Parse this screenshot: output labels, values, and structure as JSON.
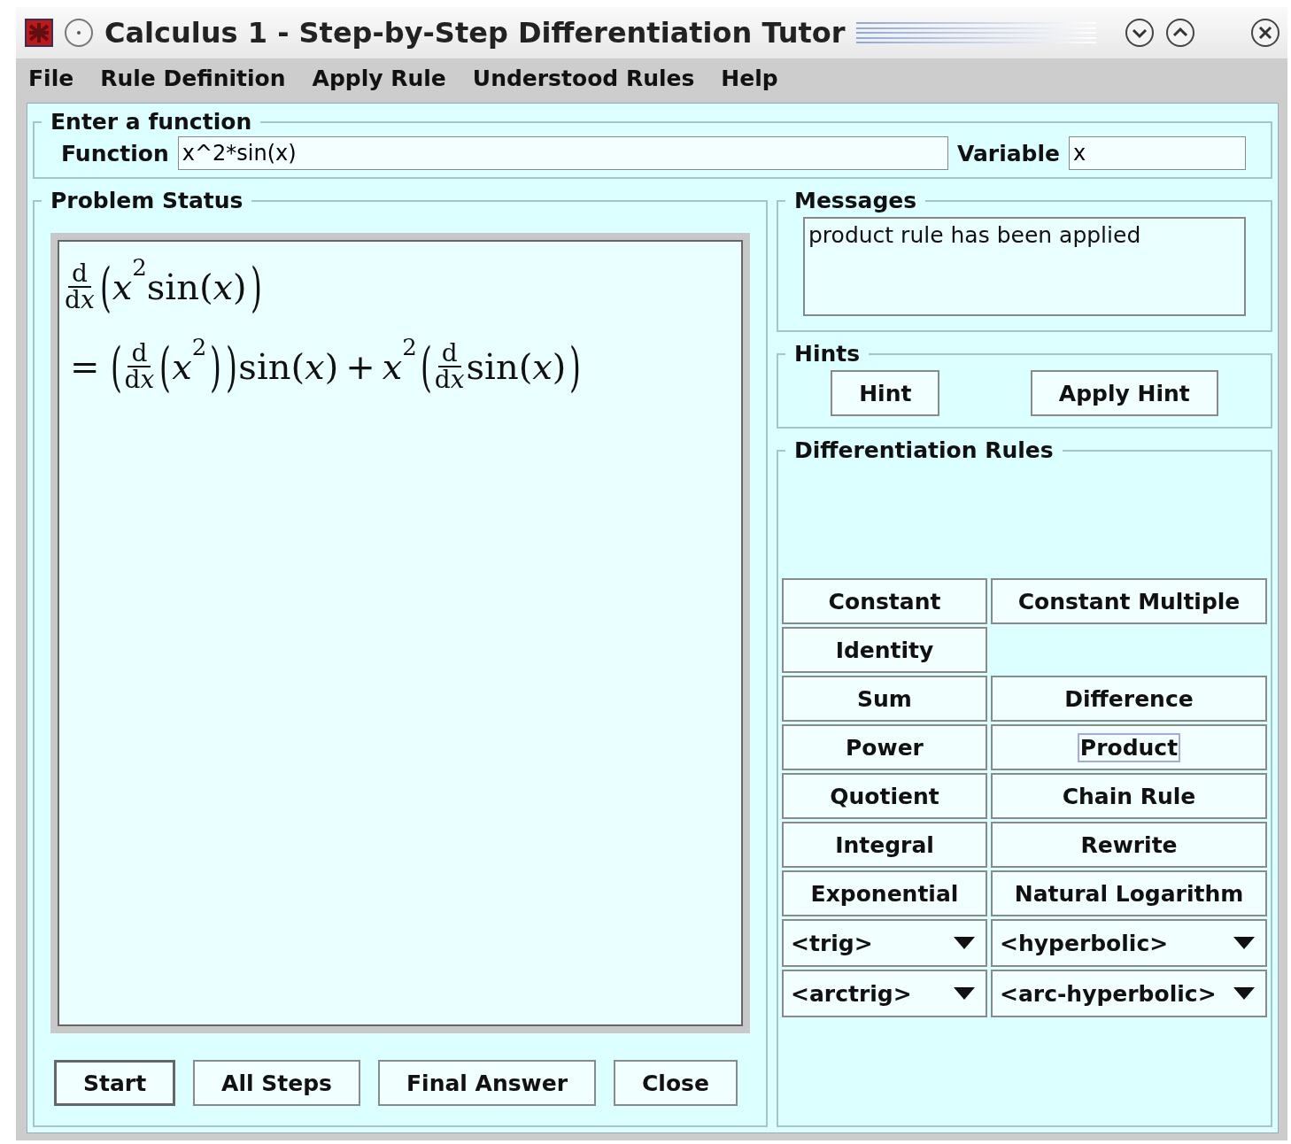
{
  "window": {
    "title": "Calculus 1 - Step-by-Step Differentiation Tutor"
  },
  "menu": [
    "File",
    "Rule Definition",
    "Apply Rule",
    "Understood Rules",
    "Help"
  ],
  "input_group": {
    "title": "Enter a function",
    "function_label": "Function",
    "function_value": "x^2*sin(x)",
    "variable_label": "Variable",
    "variable_value": "x"
  },
  "problem_status": {
    "title": "Problem Status",
    "lines": [
      [
        {
          "kind": "frac",
          "num": "d",
          "den": "d",
          "den_var": "x"
        },
        {
          "kind": "bigparen",
          "text": "("
        },
        {
          "kind": "var",
          "text": "x"
        },
        {
          "kind": "sup",
          "text": "2"
        },
        {
          "kind": "fn",
          "text": "sin"
        },
        {
          "kind": "paren",
          "text": "("
        },
        {
          "kind": "var",
          "text": "x"
        },
        {
          "kind": "paren",
          "text": ")"
        },
        {
          "kind": "bigparen",
          "text": ")"
        }
      ],
      [
        {
          "kind": "op",
          "text": "="
        },
        {
          "kind": "bigparen",
          "text": "("
        },
        {
          "kind": "frac",
          "num": "d",
          "den": "d",
          "den_var": "x"
        },
        {
          "kind": "bigparen",
          "text": "("
        },
        {
          "kind": "var",
          "text": "x"
        },
        {
          "kind": "sup",
          "text": "2"
        },
        {
          "kind": "bigparen",
          "text": ")"
        },
        {
          "kind": "bigparen",
          "text": ")"
        },
        {
          "kind": "fn",
          "text": "sin"
        },
        {
          "kind": "paren",
          "text": "("
        },
        {
          "kind": "var",
          "text": "x"
        },
        {
          "kind": "paren",
          "text": ")"
        },
        {
          "kind": "op",
          "text": "+"
        },
        {
          "kind": "var",
          "text": "x"
        },
        {
          "kind": "sup",
          "text": "2"
        },
        {
          "kind": "bigparen",
          "text": "("
        },
        {
          "kind": "frac",
          "num": "d",
          "den": "d",
          "den_var": "x"
        },
        {
          "kind": "fn",
          "text": "sin"
        },
        {
          "kind": "paren",
          "text": "("
        },
        {
          "kind": "var",
          "text": "x"
        },
        {
          "kind": "paren",
          "text": ")"
        },
        {
          "kind": "bigparen",
          "text": ")"
        }
      ]
    ],
    "buttons": [
      {
        "label": "Start",
        "default": true
      },
      {
        "label": "All Steps",
        "default": false
      },
      {
        "label": "Final Answer",
        "default": false
      },
      {
        "label": "Close",
        "default": false
      }
    ]
  },
  "messages": {
    "title": "Messages",
    "text": "product rule has been applied"
  },
  "hints": {
    "title": "Hints",
    "buttons": [
      "Hint",
      "Apply Hint"
    ]
  },
  "rules": {
    "title": "Differentiation Rules",
    "rows": [
      [
        {
          "kind": "button",
          "label": "Constant",
          "focused": false
        },
        {
          "kind": "button",
          "label": "Constant Multiple",
          "focused": false
        }
      ],
      [
        {
          "kind": "button",
          "label": "Identity",
          "focused": false
        }
      ],
      [
        {
          "kind": "button",
          "label": "Sum",
          "focused": false
        },
        {
          "kind": "button",
          "label": "Difference",
          "focused": false
        }
      ],
      [
        {
          "kind": "button",
          "label": "Power",
          "focused": false
        },
        {
          "kind": "button",
          "label": "Product",
          "focused": true
        }
      ],
      [
        {
          "kind": "button",
          "label": "Quotient",
          "focused": false
        },
        {
          "kind": "button",
          "label": "Chain Rule",
          "focused": false
        }
      ],
      [
        {
          "kind": "button",
          "label": "Integral",
          "focused": false
        },
        {
          "kind": "button",
          "label": "Rewrite",
          "focused": false
        }
      ],
      [
        {
          "kind": "button",
          "label": "Exponential",
          "focused": false
        },
        {
          "kind": "button",
          "label": "Natural Logarithm",
          "focused": false
        }
      ],
      [
        {
          "kind": "dropdown",
          "label": "<trig>"
        },
        {
          "kind": "dropdown",
          "label": "<hyperbolic>"
        }
      ],
      [
        {
          "kind": "dropdown",
          "label": "<arctrig>"
        },
        {
          "kind": "dropdown",
          "label": "<arc-hyperbolic>"
        }
      ]
    ]
  }
}
